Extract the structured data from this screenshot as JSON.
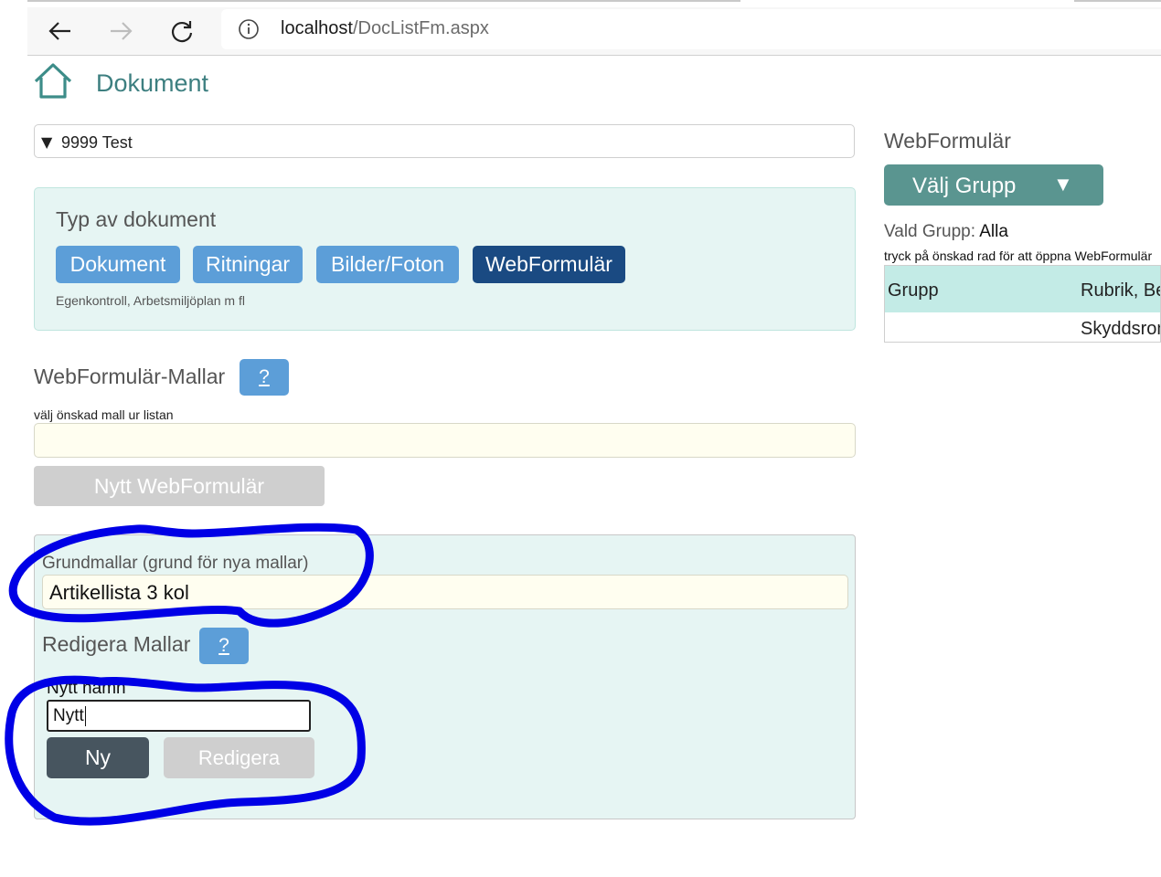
{
  "browser": {
    "address": {
      "host": "localhost",
      "path": "/DocListFm.aspx"
    },
    "icons": {
      "back": "arrow-left-icon",
      "forward": "arrow-right-icon",
      "reload": "reload-icon",
      "info": "info-icon"
    }
  },
  "header": {
    "title": "Dokument",
    "icon": "home-icon"
  },
  "org_select": {
    "arrow": "▼",
    "value": "9999 Test"
  },
  "doc_types": {
    "heading": "Typ av dokument",
    "buttons": [
      {
        "label": "Dokument"
      },
      {
        "label": "Ritningar"
      },
      {
        "label": "Bilder/Foton"
      },
      {
        "label": "WebFormulär"
      }
    ],
    "active_index": 3,
    "subtitle": "Egenkontroll, Arbetsmiljöplan m fl"
  },
  "templates": {
    "title": "WebFormulär-Mallar",
    "help_label": "?",
    "hint": "välj önskad mall ur listan",
    "selected_value": "",
    "new_button": "Nytt WebFormulär"
  },
  "edit": {
    "base_label": "Grundmallar (grund för nya mallar)",
    "base_value": "Artikellista 3 kol",
    "title": "Redigera Mallar",
    "help_label": "?",
    "new_name_label": "Nytt namn",
    "new_name_value": "Nytt",
    "new_button": "Ny",
    "edit_button": "Redigera"
  },
  "right_panel": {
    "title": "WebFormulär",
    "group_button": "Välj Grupp",
    "group_arrow": "▼",
    "chosen_label": "Vald Grupp:",
    "chosen_value": "Alla",
    "instruction": "tryck på önskad rad för att öppna WebFormulär",
    "table": {
      "headers": [
        "Grupp",
        "Rubrik, Beskrivning"
      ],
      "rows": [
        [
          "",
          "Skyddsrond"
        ]
      ]
    }
  },
  "colors": {
    "accent_teal": "#3d7f80",
    "button_blue": "#5c9ed8",
    "button_active": "#1a4a82",
    "panel_bg": "#e6f5f3",
    "annotation_ink": "#0000e6"
  }
}
